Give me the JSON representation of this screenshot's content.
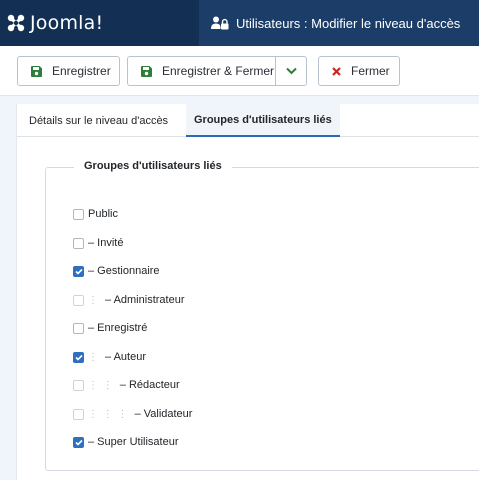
{
  "header": {
    "brand_name": "Joomla!",
    "page_title": "Utilisateurs : Modifier le niveau d'accès"
  },
  "toolbar": {
    "save_label": "Enregistrer",
    "save_close_label": "Enregistrer & Fermer",
    "close_label": "Fermer"
  },
  "tabs": [
    {
      "label": "Détails sur le niveau d'accès",
      "active": false
    },
    {
      "label": "Groupes d'utilisateurs liés",
      "active": true
    }
  ],
  "groups": {
    "legend": "Groupes d'utilisateurs liés",
    "items": [
      {
        "label": "Public",
        "checked": false,
        "indent": ""
      },
      {
        "label": "– Invité",
        "checked": false,
        "indent": ""
      },
      {
        "label": "– Gestionnaire",
        "checked": true,
        "indent": ""
      },
      {
        "label": "– Administrateur",
        "checked": false,
        "indent": "⋮"
      },
      {
        "label": "– Enregistré",
        "checked": false,
        "indent": ""
      },
      {
        "label": "– Auteur",
        "checked": true,
        "indent": "⋮"
      },
      {
        "label": "– Rédacteur",
        "checked": false,
        "indent": "⋮ ⋮"
      },
      {
        "label": "– Validateur",
        "checked": false,
        "indent": "⋮ ⋮ ⋮"
      },
      {
        "label": "– Super Utilisateur",
        "checked": true,
        "indent": ""
      }
    ]
  },
  "colors": {
    "brand_bg": "#132f53",
    "title_bg": "#1b3d68",
    "save_icon": "#2f7d3b",
    "close_icon": "#c52827",
    "checkbox_checked": "#2f6fc0",
    "tab_active_border": "#2a69b8"
  },
  "icons": {
    "brand": "joomla-logo-icon",
    "title": "users-lock-icon",
    "save": "floppy-disk-icon",
    "save_close": "floppy-disk-icon",
    "dropdown": "chevron-down-icon",
    "close": "x-icon",
    "checked": "check-icon"
  }
}
